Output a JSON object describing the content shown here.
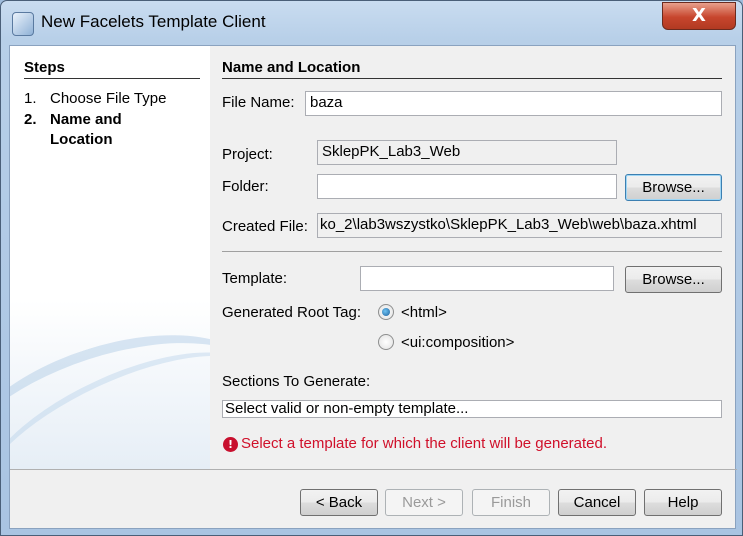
{
  "window": {
    "title": "New Facelets Template Client",
    "close_label": "X"
  },
  "steps": {
    "heading": "Steps",
    "items": [
      {
        "num": "1.",
        "label": "Choose File Type",
        "current": false
      },
      {
        "num": "2.",
        "label": "Name and Location",
        "current": true
      }
    ]
  },
  "panel": {
    "heading": "Name and Location",
    "file_name": {
      "label": "File Name:",
      "value": "baza"
    },
    "project": {
      "label": "Project:",
      "value": "SklepPK_Lab3_Web"
    },
    "folder": {
      "label": "Folder:",
      "value": "",
      "browse": "Browse..."
    },
    "created_file": {
      "label": "Created File:",
      "value": "ko_2\\lab3wszystko\\SklepPK_Lab3_Web\\web\\baza.xhtml"
    },
    "template": {
      "label": "Template:",
      "value": "",
      "browse": "Browse..."
    },
    "root_tag": {
      "label": "Generated Root Tag:",
      "options": [
        {
          "label": "<html>",
          "selected": true
        },
        {
          "label": "<ui:composition>",
          "selected": false
        }
      ]
    },
    "sections": {
      "label": "Sections To Generate:",
      "value": "Select valid or non-empty template..."
    },
    "error": {
      "icon": "error-icon",
      "message": "Select a template for which the client will be generated.",
      "color": "#d0102a"
    }
  },
  "buttons": {
    "back": "< Back",
    "next": "Next >",
    "finish": "Finish",
    "cancel": "Cancel",
    "help": "Help"
  }
}
